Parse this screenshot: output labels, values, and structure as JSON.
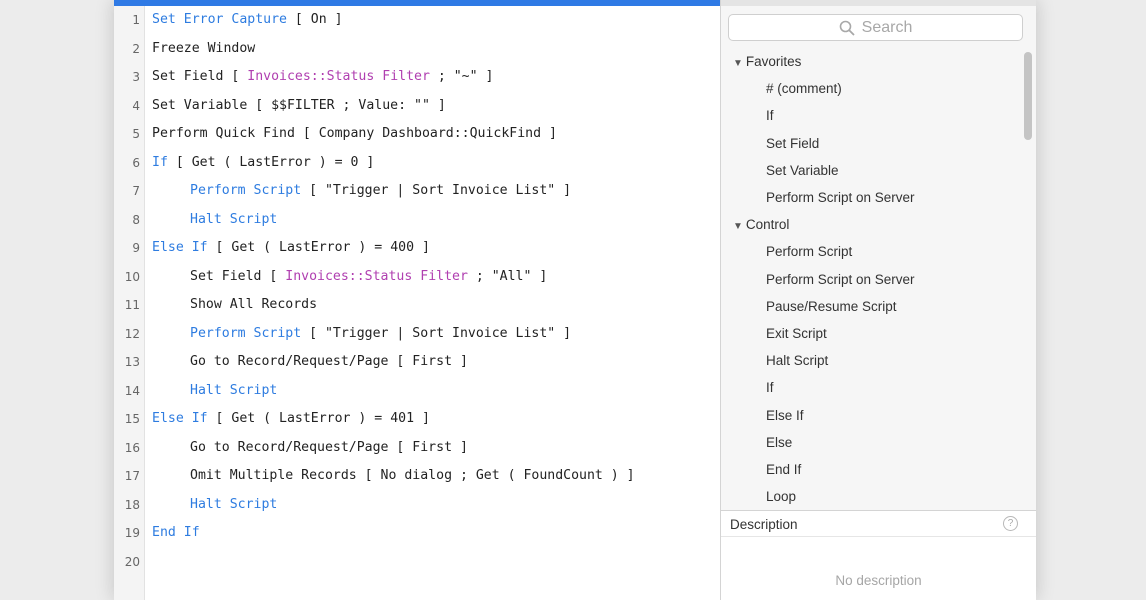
{
  "editor": {
    "lines": [
      {
        "num": "1",
        "indent": false,
        "parts": [
          {
            "t": "Set Error Capture",
            "c": "kw"
          },
          {
            "t": " [ On ]",
            "c": "txt"
          }
        ]
      },
      {
        "num": "2",
        "indent": false,
        "parts": [
          {
            "t": "Freeze Window",
            "c": "txt"
          }
        ]
      },
      {
        "num": "3",
        "indent": false,
        "parts": [
          {
            "t": "Set Field [ ",
            "c": "txt"
          },
          {
            "t": "Invoices::Status Filter",
            "c": "fld"
          },
          {
            "t": " ; \"~\" ]",
            "c": "txt"
          }
        ]
      },
      {
        "num": "4",
        "indent": false,
        "parts": [
          {
            "t": "Set Variable [ $$FILTER ; Value: \"\" ]",
            "c": "txt"
          }
        ]
      },
      {
        "num": "5",
        "indent": false,
        "parts": [
          {
            "t": "Perform Quick Find [ Company Dashboard::QuickFind ]",
            "c": "txt"
          }
        ]
      },
      {
        "num": "6",
        "indent": false,
        "parts": [
          {
            "t": "If",
            "c": "kw"
          },
          {
            "t": " [ Get ( LastError ) = 0 ]",
            "c": "txt"
          }
        ]
      },
      {
        "num": "7",
        "indent": true,
        "parts": [
          {
            "t": "Perform Script",
            "c": "kw"
          },
          {
            "t": " [ \"Trigger | Sort Invoice List\" ]",
            "c": "txt"
          }
        ]
      },
      {
        "num": "8",
        "indent": true,
        "parts": [
          {
            "t": "Halt Script",
            "c": "kw"
          }
        ]
      },
      {
        "num": "9",
        "indent": false,
        "parts": [
          {
            "t": "Else If",
            "c": "kw"
          },
          {
            "t": " [ Get ( LastError ) = 400 ]",
            "c": "txt"
          }
        ]
      },
      {
        "num": "10",
        "indent": true,
        "parts": [
          {
            "t": "Set Field [ ",
            "c": "txt"
          },
          {
            "t": "Invoices::Status Filter",
            "c": "fld"
          },
          {
            "t": " ; \"All\" ]",
            "c": "txt"
          }
        ]
      },
      {
        "num": "11",
        "indent": true,
        "parts": [
          {
            "t": "Show All Records",
            "c": "txt"
          }
        ]
      },
      {
        "num": "12",
        "indent": true,
        "parts": [
          {
            "t": "Perform Script",
            "c": "kw"
          },
          {
            "t": " [ \"Trigger | Sort Invoice List\" ]",
            "c": "txt"
          }
        ]
      },
      {
        "num": "13",
        "indent": true,
        "parts": [
          {
            "t": "Go to Record/Request/Page [ First ]",
            "c": "txt"
          }
        ]
      },
      {
        "num": "14",
        "indent": true,
        "parts": [
          {
            "t": "Halt Script",
            "c": "kw"
          }
        ]
      },
      {
        "num": "15",
        "indent": false,
        "parts": [
          {
            "t": "Else If",
            "c": "kw"
          },
          {
            "t": " [ Get ( LastError ) = 401 ]",
            "c": "txt"
          }
        ]
      },
      {
        "num": "16",
        "indent": true,
        "parts": [
          {
            "t": "Go to Record/Request/Page [ First ]",
            "c": "txt"
          }
        ]
      },
      {
        "num": "17",
        "indent": true,
        "parts": [
          {
            "t": "Omit Multiple Records [ No dialog ; Get ( FoundCount ) ]",
            "c": "txt"
          }
        ]
      },
      {
        "num": "18",
        "indent": true,
        "parts": [
          {
            "t": "Halt Script",
            "c": "kw"
          }
        ]
      },
      {
        "num": "19",
        "indent": false,
        "parts": [
          {
            "t": "End If",
            "c": "kw"
          }
        ]
      },
      {
        "num": "20",
        "indent": false,
        "parts": []
      }
    ]
  },
  "panel": {
    "search_placeholder": "Search",
    "categories": [
      {
        "label": "Favorites",
        "items": [
          "# (comment)",
          "If",
          "Set Field",
          "Set Variable",
          "Perform Script on Server"
        ]
      },
      {
        "label": "Control",
        "items": [
          "Perform Script",
          "Perform Script on Server",
          "Pause/Resume Script",
          "Exit Script",
          "Halt Script",
          "If",
          "Else If",
          "Else",
          "End If",
          "Loop"
        ]
      }
    ],
    "description_title": "Description",
    "description_text": "No description"
  },
  "colors": {
    "keyword": "#2e7ce0",
    "field": "#b03fb0",
    "selection": "#2f7ae5"
  }
}
